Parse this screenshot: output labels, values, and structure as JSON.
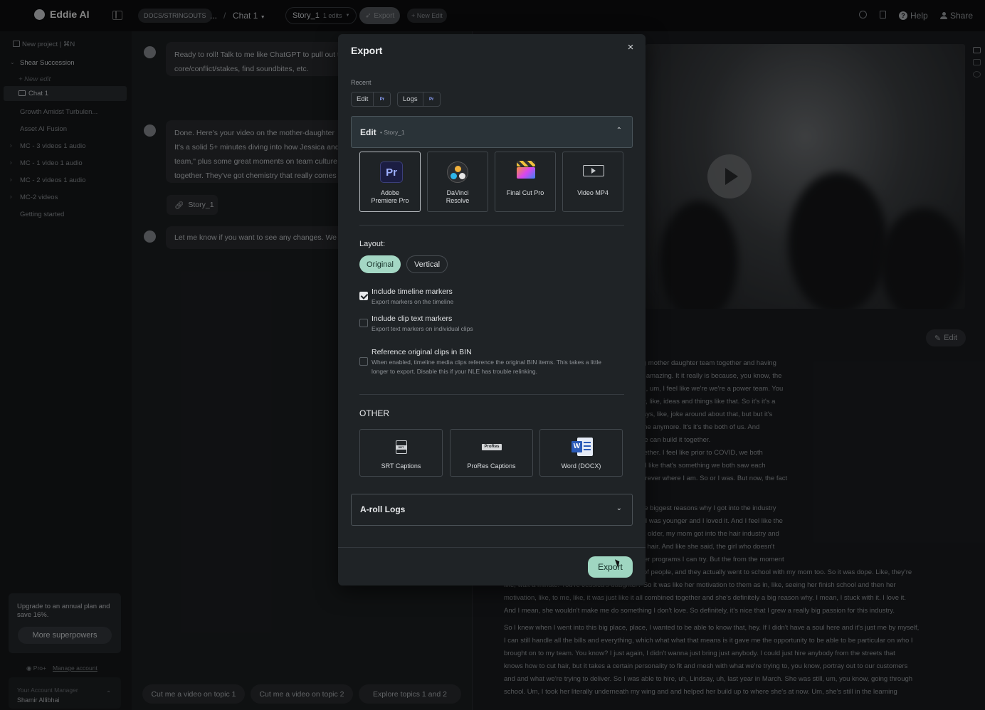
{
  "app": {
    "name": "Eddie AI"
  },
  "topbar": {
    "workspace": "DOCS/STRINGOUTS",
    "ellipsis": "...",
    "separator": "/",
    "chat_name": "Chat 1",
    "story_name": "Story_1",
    "story_edits": "1 edits",
    "export_label": "Export",
    "new_edit_label": "+ New Edit",
    "help_label": "Help",
    "share_label": "Share"
  },
  "sidebar": {
    "new_project": "New project | ⌘N",
    "project_name": "Shear Succession",
    "new_edit": "+ New edit",
    "active_chat": "Chat 1",
    "items": [
      "Growth Amidst Turbulen...",
      "Asset AI Fusion",
      "MC - 3 videos 1 audio",
      "MC - 1 video 1 audio",
      "MC - 2 videos 1 audio",
      "MC-2 videos",
      "Getting started"
    ],
    "upgrade_text": "Upgrade to an annual plan and save 16%.",
    "superpowers_label": "More superpowers",
    "plan_label": "Pro+",
    "manage_account": "Manage account",
    "account_manager_label": "Your Account Manager",
    "account_manager_name": "Shamir Allibhai"
  },
  "chat": {
    "messages": [
      [
        "Ready to roll! Talk to me like ChatGPT to pull out th",
        "core/conflict/stakes, find soundbites, etc."
      ],
      [
        "Done. Here's your video on the mother-daughter",
        "It's a solid 5+ minutes diving into how Jessica and",
        "team,\" plus some great moments on team culture",
        "together. They've got chemistry that really comes"
      ],
      [
        "Let me know if you want to see any changes. We c"
      ]
    ],
    "story_chip": "Story_1",
    "suggestions": [
      "Cut me a video on topic 1",
      "Cut me a video on topic 2",
      "Explore topics 1 and 2"
    ]
  },
  "rightpane": {
    "edit_label": "Edit",
    "transcript": [
      "ou guys? Like, what does it mean to be working mother daughter team together and having",
      "? Having a mother daughter team here, it's just amazing. It it really is because, you know, the",
      "but I now am able to bring my daughter on. And, um, I feel like we're we're a power team. You",
      "ce off her. You know? We kinda give each other, like, ideas and things like that. So it's it's a",
      "we have two chairs in between us, and we always, like, joke around about that, but but it's",
      "mething together. You know? Now it's not just me anymore. It's it's the both of us. And",
      "lly be hers, um, one day. So it's it's great that we can build it together.",
      "hink we ever would have imagined working together. I feel like prior to COVID, we both",
      "completely different styles of haircuts. And I feel like that's something we both saw each",
      "orever where she was, and I was gonna stay forever where I am. So or I was. But now, the fact",
      "",
      "ole in your life?",
      "reer, my industry for the sake of she's one of the biggest reasons why I got into the industry",
      "y dad used to take me to the barbershop when I was younger and I loved it. And I feel like the",
      "he didn't really want me there. But as I, like, got older, my mom got into the hair industry and",
      "ol. I was like, alright. Well, let me just try cutting hair. And like she said, the girl who doesn't",
      "t try it if I don't like it. I mean, there's like 30 other programs I can try. But the from the moment",
      "I walked in, I feel like I had such a great group of people, and they actually went to school with my mom too. So it was dope. Like, they're",
      "like, wait a minute. You're Jessica's daughter? So it was like her motivation to them as in, like, seeing her finish school and then her",
      "motivation, like, to me, like, it was just like it all combined together and she's definitely a big reason why. I mean, I stuck with it. I love it.",
      "And I mean, she wouldn't make me do something I don't love. So definitely, it's nice that I grew a really big passion for this industry.",
      "",
      "So I knew when I went into this big place, place, I wanted to be able to know that, hey. If I didn't have a soul here and it's just me by myself,",
      "I can still handle all the bills and everything, which what what that means is it gave me the opportunity to be able to be particular on who I",
      "brought on to my team. You know? I just again, I didn't wanna just bring just anybody. I could just hire anybody from the streets that",
      "knows how to cut hair, but it takes a certain personality to fit and mesh with what we're trying to, you know, portray out to our customers",
      "and and what we're trying to deliver. So I was able to hire, uh, Lindsay, uh, last year in March. She was still, um, you know, going through",
      "school. Um, I took her literally underneath my wing and and helped her build up to where she's at now. Um, she's still in the learning"
    ]
  },
  "modal": {
    "title": "Export",
    "recent_label": "Recent",
    "recent_chips": [
      {
        "label": "Edit",
        "badge": "Pr"
      },
      {
        "label": "Logs",
        "badge": "Pr"
      }
    ],
    "edit_section": {
      "title": "Edit",
      "dot": "•",
      "subtitle": "Story_1"
    },
    "apps": [
      {
        "line1": "Adobe",
        "line2": "Premiere Pro",
        "logo_text": "Pr",
        "selected": true
      },
      {
        "line1": "DaVinci",
        "line2": "Resolve",
        "logo_text": "",
        "selected": false
      },
      {
        "line1": "Final Cut Pro",
        "line2": "",
        "logo_text": "",
        "selected": false
      },
      {
        "line1": "Video MP4",
        "line2": "",
        "logo_text": "",
        "selected": false
      }
    ],
    "layout_label": "Layout:",
    "layout_options": [
      "Original",
      "Vertical"
    ],
    "layout_selected": "Original",
    "options": [
      {
        "title": "Include timeline markers",
        "desc": "Export markers on the timeline",
        "checked": true
      },
      {
        "title": "Include clip text markers",
        "desc": "Export text markers on individual clips",
        "checked": false
      },
      {
        "title": "Reference original clips in BIN",
        "desc": "When enabled, timeline media clips reference the original BIN items. This takes a little longer to export. Disable this if your NLE has trouble relinking.",
        "checked": false
      }
    ],
    "other_label": "OTHER",
    "other_items": [
      {
        "label": "SRT Captions",
        "logo_text": "SRT"
      },
      {
        "label": "ProRes Captions",
        "logo_text": "ProRes"
      },
      {
        "label": "Word (DOCX)",
        "logo_text": "W"
      }
    ],
    "aroll_label": "A-roll Logs",
    "export_button": "Export",
    "close_icon": "×"
  }
}
